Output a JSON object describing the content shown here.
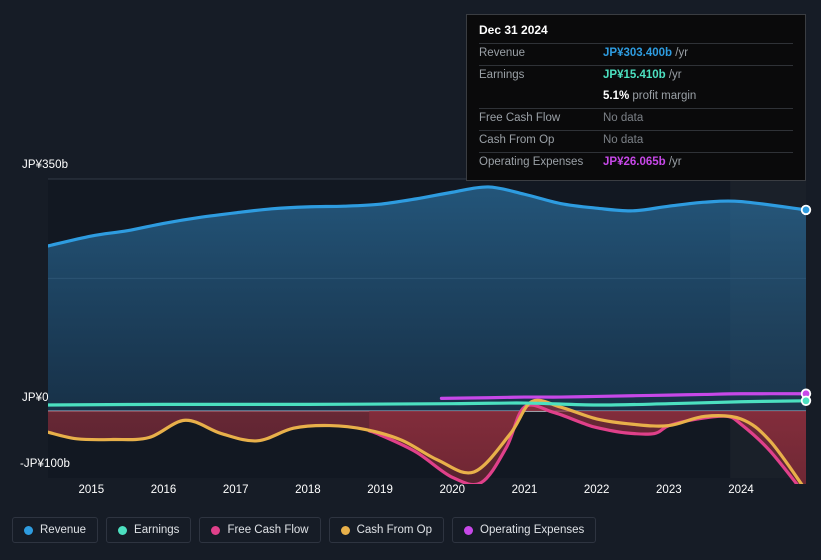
{
  "tooltip": {
    "date": "Dec 31 2024",
    "rows": [
      {
        "label": "Revenue",
        "value": "JP¥303.400b",
        "unit": "/yr",
        "color": "#2e9ce0"
      },
      {
        "label": "Earnings",
        "value": "JP¥15.410b",
        "unit": "/yr",
        "color": "#4ce0c0"
      },
      {
        "label": "",
        "value": "5.1%",
        "unit": "profit margin",
        "color": "#ffffff"
      },
      {
        "label": "Free Cash Flow",
        "value": "No data",
        "unit": "",
        "color": "#7c8187"
      },
      {
        "label": "Cash From Op",
        "value": "No data",
        "unit": "",
        "color": "#7c8187"
      },
      {
        "label": "Operating Expenses",
        "value": "JP¥26.065b",
        "unit": "/yr",
        "color": "#c748e8"
      }
    ]
  },
  "legend": {
    "items": [
      {
        "label": "Revenue",
        "color": "#2e9ce0"
      },
      {
        "label": "Earnings",
        "color": "#4ce0c0"
      },
      {
        "label": "Free Cash Flow",
        "color": "#e0408a"
      },
      {
        "label": "Cash From Op",
        "color": "#e8b04a"
      },
      {
        "label": "Operating Expenses",
        "color": "#c748e8"
      }
    ]
  },
  "chart_data": {
    "type": "line",
    "title": "",
    "xlabel": "",
    "ylabel": "",
    "currency": "JP¥",
    "units": "billions",
    "grid": true,
    "legend_position": "bottom",
    "ylim": [
      -130,
      350
    ],
    "yticks": [
      350,
      0,
      -100
    ],
    "ytick_labels": [
      "JP¥350b",
      "JP¥0",
      "-JP¥100b"
    ],
    "gridlines": [
      350,
      200,
      0
    ],
    "x": [
      2014.4,
      2015,
      2016,
      2017,
      2018,
      2019,
      2020,
      2021,
      2022,
      2023,
      2024,
      2024.9
    ],
    "xticks": [
      2015,
      2016,
      2017,
      2018,
      2019,
      2020,
      2021,
      2022,
      2023,
      2024
    ],
    "xtick_labels": [
      "2015",
      "2016",
      "2017",
      "2018",
      "2019",
      "2020",
      "2021",
      "2022",
      "2023",
      "2024"
    ],
    "highlight_band": {
      "from": 2023.85,
      "to": 2024.9,
      "label": ""
    },
    "series": [
      {
        "name": "Revenue",
        "color": "#2e9ce0",
        "fill": "rgba(40,110,165,0.40)",
        "x": [
          2014.4,
          2015,
          2015.5,
          2016,
          2016.5,
          2017,
          2017.5,
          2018,
          2018.5,
          2019,
          2019.5,
          2020,
          2020.5,
          2021,
          2021.5,
          2022,
          2022.5,
          2023,
          2023.5,
          2024,
          2024.9
        ],
        "values": [
          249,
          264,
          272,
          283,
          292,
          299,
          305,
          308,
          309,
          312,
          320,
          330,
          338,
          327,
          313,
          306,
          302,
          309,
          315,
          316,
          303.4
        ]
      },
      {
        "name": "Earnings",
        "color": "#4ce0c0",
        "x": [
          2014.4,
          2016,
          2018,
          2020,
          2021,
          2022,
          2023,
          2024,
          2024.9
        ],
        "values": [
          9,
          10,
          10,
          11,
          12,
          9,
          11,
          14,
          15.41
        ]
      },
      {
        "name": "Free Cash Flow",
        "color": "#e0408a",
        "fill": "rgba(150,40,55,0.50)",
        "x": [
          2018.85,
          2019,
          2019.5,
          2020,
          2020.4,
          2020.75,
          2021,
          2021.4,
          2021.8,
          2022,
          2022.4,
          2022.8,
          2023,
          2023.4,
          2023.8,
          2024,
          2024.4,
          2024.9
        ],
        "values": [
          -30,
          -36,
          -62,
          -100,
          -108,
          -55,
          6,
          -2,
          -18,
          -25,
          -33,
          -34,
          -22,
          -12,
          -8,
          -20,
          -60,
          -128
        ]
      },
      {
        "name": "Cash From Op",
        "color": "#e8b04a",
        "fill": "rgba(150,40,55,0.50)",
        "x": [
          2014.4,
          2014.8,
          2015.3,
          2015.8,
          2016.3,
          2016.8,
          2017.3,
          2017.8,
          2018.3,
          2018.8,
          2019.3,
          2019.8,
          2020.3,
          2020.8,
          2021.1,
          2021.5,
          2022,
          2022.5,
          2023,
          2023.5,
          2024,
          2024.4,
          2024.9
        ],
        "values": [
          -32,
          -42,
          -43,
          -40,
          -14,
          -34,
          -45,
          -26,
          -22,
          -28,
          -44,
          -74,
          -92,
          -35,
          14,
          6,
          -12,
          -20,
          -22,
          -8,
          -12,
          -45,
          -120
        ]
      },
      {
        "name": "Operating Expenses",
        "color": "#c748e8",
        "x": [
          2019.85,
          2020.5,
          2021,
          2021.5,
          2022,
          2022.5,
          2023,
          2023.5,
          2024,
          2024.9
        ],
        "values": [
          19,
          20,
          21,
          21,
          22,
          23,
          24,
          25,
          26,
          26.065
        ]
      }
    ],
    "end_markers": [
      {
        "name": "Revenue",
        "color": "#2e9ce0",
        "value": 303.4
      },
      {
        "name": "Operating Expenses",
        "color": "#c748e8",
        "value": 26.065
      },
      {
        "name": "Earnings",
        "color": "#4ce0c0",
        "value": 15.41
      }
    ]
  }
}
